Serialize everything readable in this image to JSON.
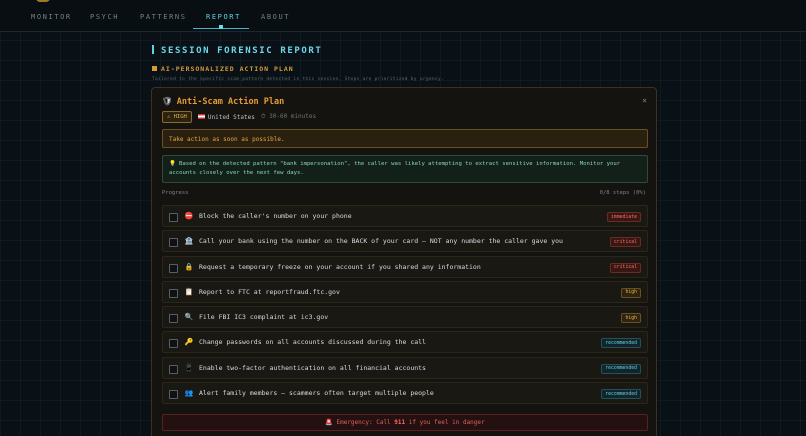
{
  "nav": {
    "items": [
      {
        "label": "MONITOR"
      },
      {
        "label": "PSYCH"
      },
      {
        "label": "PATTERNS"
      },
      {
        "label": "REPORT"
      },
      {
        "label": "ABOUT"
      }
    ],
    "active": "REPORT"
  },
  "section": {
    "title": "SESSION FORENSIC REPORT",
    "subhead": "AI-PERSONALIZED ACTION PLAN",
    "tagline": "Tailored to the specific scam pattern detected in this session. Steps are prioritized by urgency."
  },
  "plan": {
    "title": "Anti-Scam Action Plan",
    "title_icon": "shield-icon",
    "close_label": "×",
    "severity": "HIGH",
    "severity_icon": "warning-icon",
    "country": "United States",
    "duration": "30-60 minutes",
    "urgent_message": "Take action as soon as possible.",
    "summary": "Based on the detected pattern \"bank impersonation\", the caller was likely attempting to extract sensitive information. Monitor your accounts closely over the next few days.",
    "progress_label": "Progress",
    "progress_count": "0/8 steps (0%)",
    "steps": [
      {
        "icon": "⛔",
        "icon_name": "block-icon",
        "text": "Block the caller's number on your phone",
        "badge": "immediate"
      },
      {
        "icon": "🏦",
        "icon_name": "bank-icon",
        "text": "Call your bank using the number on the BACK of your card — NOT any number the caller gave you",
        "badge": "critical"
      },
      {
        "icon": "🔒",
        "icon_name": "lock-icon",
        "text": "Request a temporary freeze on your account if you shared any information",
        "badge": "critical"
      },
      {
        "icon": "📋",
        "icon_name": "clipboard-icon",
        "text": "Report to FTC at reportfraud.ftc.gov",
        "badge": "high"
      },
      {
        "icon": "🔍",
        "icon_name": "magnifier-icon",
        "text": "File FBI IC3 complaint at ic3.gov",
        "badge": "high"
      },
      {
        "icon": "🔑",
        "icon_name": "key-icon",
        "text": "Change passwords on all accounts discussed during the call",
        "badge": "recommended"
      },
      {
        "icon": "📱",
        "icon_name": "phone-icon",
        "text": "Enable two-factor authentication on all financial accounts",
        "badge": "recommended"
      },
      {
        "icon": "👥",
        "icon_name": "people-icon",
        "text": "Alert family members — scammers often target multiple people",
        "badge": "recommended"
      }
    ],
    "emergency_prefix": "Emergency: Call",
    "emergency_number": "911",
    "emergency_suffix": "if you feel in danger"
  },
  "colors": {
    "accent": "#5fd2e6",
    "warning": "#e89a36",
    "danger": "#e0605a"
  }
}
